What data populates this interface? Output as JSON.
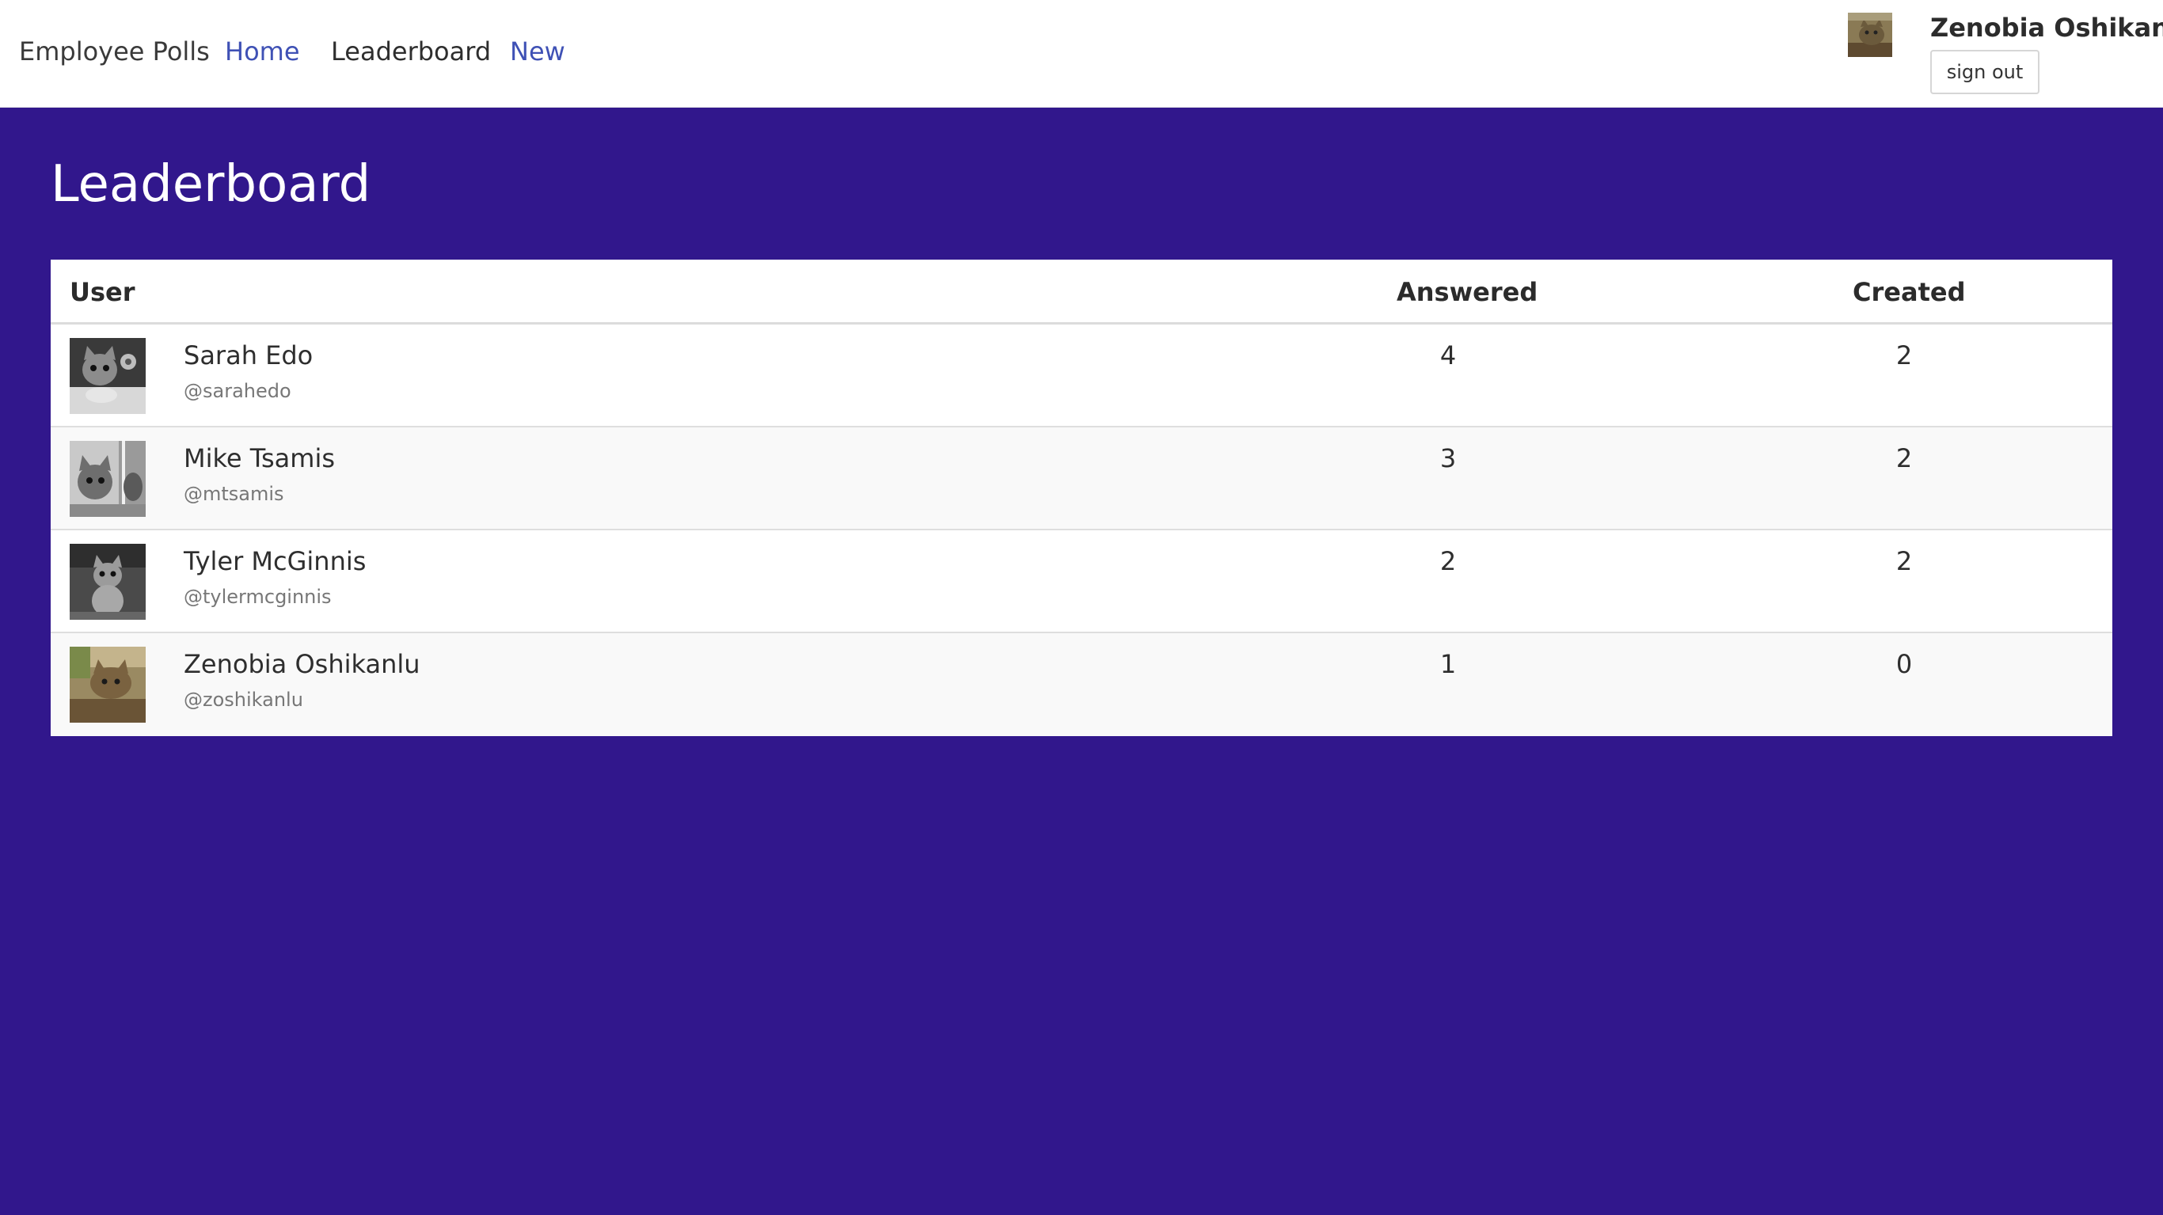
{
  "nav": {
    "brand": "Employee Polls",
    "home": "Home",
    "leaderboard": "Leaderboard",
    "new": "New"
  },
  "user": {
    "name": "Zenobia Oshikanlu",
    "signout_label": "sign out",
    "avatar_icon": "cat-avatar-icon"
  },
  "page": {
    "title": "Leaderboard"
  },
  "table": {
    "headers": {
      "user": "User",
      "answered": "Answered",
      "created": "Created"
    },
    "rows": [
      {
        "name": "Sarah Edo",
        "handle": "@sarahedo",
        "answered": "4",
        "created": "2"
      },
      {
        "name": "Mike Tsamis",
        "handle": "@mtsamis",
        "answered": "3",
        "created": "2"
      },
      {
        "name": "Tyler McGinnis",
        "handle": "@tylermcginnis",
        "answered": "2",
        "created": "2"
      },
      {
        "name": "Zenobia Oshikanlu",
        "handle": "@zoshikanlu",
        "answered": "1",
        "created": "0"
      }
    ]
  },
  "colors": {
    "page_background": "#31178c",
    "link": "#3f51b5"
  }
}
